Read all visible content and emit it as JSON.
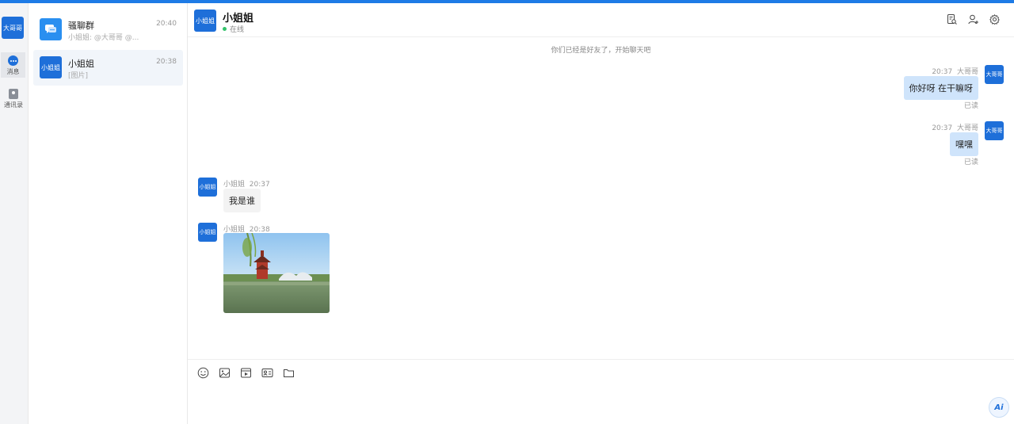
{
  "rail": {
    "user_avatar": "大哥哥",
    "items": [
      {
        "label": "消息",
        "icon": "chat-bubble-icon"
      },
      {
        "label": "通讯录",
        "icon": "contacts-icon"
      }
    ]
  },
  "conversations": [
    {
      "name": "骚聊群",
      "time": "20:40",
      "preview": "小姐姐: @大哥哥 @...",
      "avatar_icon": "group-chat-icon"
    },
    {
      "name": "小姐姐",
      "time": "20:38",
      "preview": "[图片]",
      "avatar": "小姐姐"
    }
  ],
  "chat": {
    "title": "小姐姐",
    "avatar": "小姐姐",
    "status": "在线",
    "system_note": "你们已经是好友了，开始聊天吧",
    "messages": [
      {
        "direction": "out",
        "sender": "大哥哥",
        "time": "20:37",
        "text": "你好呀 在干嘛呀",
        "read": "已读",
        "avatar": "大哥哥"
      },
      {
        "direction": "out",
        "sender": "大哥哥",
        "time": "20:37",
        "text": "嘿嘿",
        "read": "已读",
        "avatar": "大哥哥"
      },
      {
        "direction": "in",
        "sender": "小姐姐",
        "time": "20:37",
        "text": "我是谁",
        "avatar": "小姐姐"
      },
      {
        "direction": "in",
        "sender": "小姐姐",
        "time": "20:38",
        "type": "image",
        "avatar": "小姐姐"
      }
    ],
    "header_icons": [
      "chat-history-icon",
      "add-user-icon",
      "settings-icon"
    ],
    "composer_tools": [
      "emoji-icon",
      "image-icon",
      "video-icon",
      "contact-card-icon",
      "folder-icon"
    ],
    "ai_button": "Ai"
  },
  "colors": {
    "accent": "#1e7be6",
    "bubble_out": "#cfe4fb",
    "bubble_in": "#f3f3f3",
    "online": "#33c36b"
  }
}
